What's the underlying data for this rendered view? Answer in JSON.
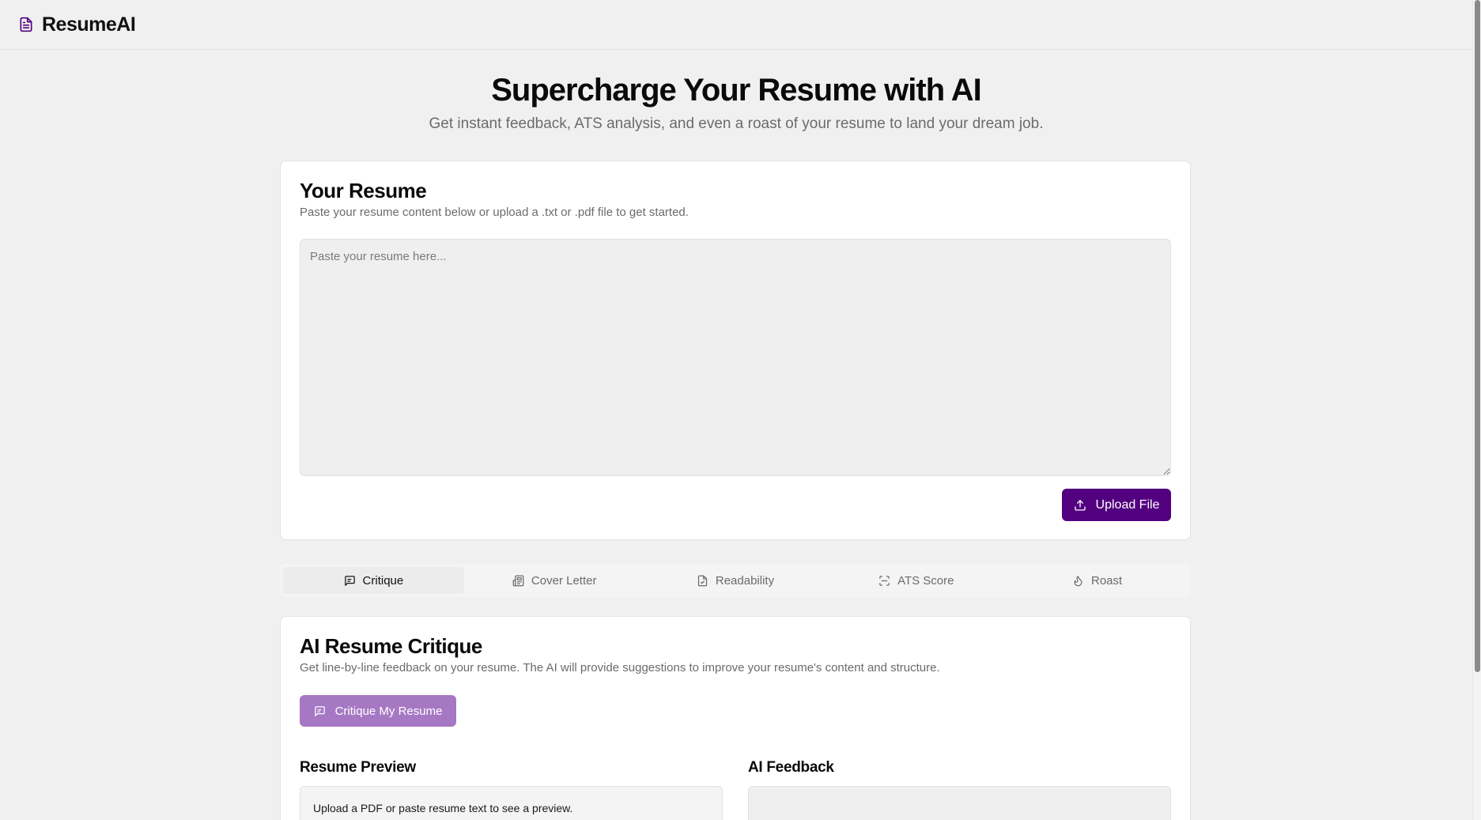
{
  "brand": {
    "name": "ResumeAI",
    "icon": "file-text-icon",
    "accent": "#52007f"
  },
  "hero": {
    "title": "Supercharge Your Resume with AI",
    "subtitle": "Get instant feedback, ATS analysis, and even a roast of your resume to land your dream job."
  },
  "resume_card": {
    "title": "Your Resume",
    "description": "Paste your resume content below or upload a .txt or .pdf file to get started.",
    "textarea_placeholder": "Paste your resume here...",
    "textarea_value": "",
    "upload_label": "Upload File",
    "upload_icon": "upload-icon"
  },
  "tabs": [
    {
      "label": "Critique",
      "icon": "message-square-icon",
      "active": true
    },
    {
      "label": "Cover Letter",
      "icon": "newspaper-icon",
      "active": false
    },
    {
      "label": "Readability",
      "icon": "file-check-icon",
      "active": false
    },
    {
      "label": "ATS Score",
      "icon": "scan-icon",
      "active": false
    },
    {
      "label": "Roast",
      "icon": "flame-icon",
      "active": false
    }
  ],
  "critique_card": {
    "title": "AI Resume Critique",
    "description": "Get line-by-line feedback on your resume. The AI will provide suggestions to improve your resume's content and structure.",
    "button_label": "Critique My Resume",
    "button_color": "#a678c4",
    "preview_title": "Resume Preview",
    "preview_text": "Upload a PDF or paste resume text to see a preview.",
    "feedback_title": "AI Feedback"
  }
}
